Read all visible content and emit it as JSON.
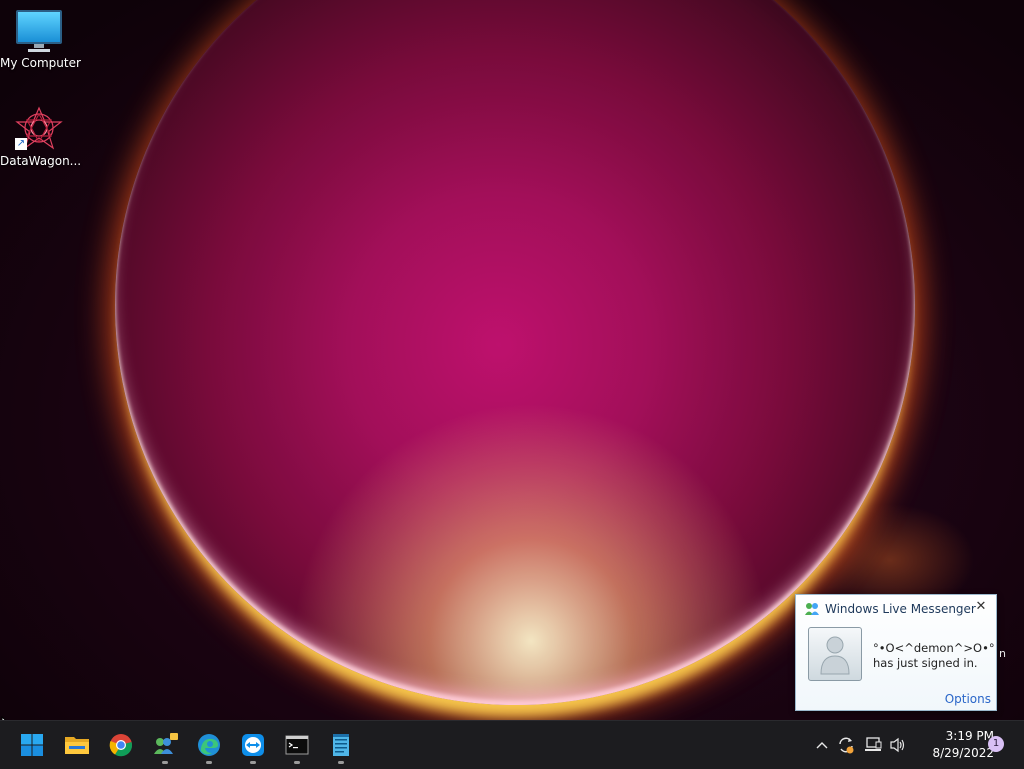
{
  "desktop": {
    "icons": [
      {
        "label": "My Computer",
        "icon": "computer-monitor-icon"
      },
      {
        "label": "DataWagon...",
        "icon": "datawagon-icon"
      }
    ]
  },
  "toast": {
    "app_name": "Windows Live Messenger",
    "line1": "°•O<^demon^>O•°",
    "line2": "has just signed in.",
    "options_link": "Options",
    "close_glyph": "✕",
    "side_fragment": "n"
  },
  "taskbar": {
    "apps": [
      {
        "name": "Start",
        "icon": "windows-start-icon"
      },
      {
        "name": "File Explorer",
        "icon": "folder-icon"
      },
      {
        "name": "Google Chrome",
        "icon": "chrome-icon"
      },
      {
        "name": "Windows Live Messenger",
        "icon": "messenger-icon"
      },
      {
        "name": "Microsoft Edge",
        "icon": "edge-icon"
      },
      {
        "name": "TeamViewer",
        "icon": "teamviewer-icon"
      },
      {
        "name": "Command Prompt",
        "icon": "terminal-icon"
      },
      {
        "name": "Notepad",
        "icon": "notepad-icon"
      }
    ],
    "tray": {
      "chevron_glyph": "^",
      "time": "3:19 PM",
      "date": "8/29/2022",
      "notification_count": "1"
    }
  },
  "colors": {
    "taskbar_bg": "#1c1c1f",
    "accent_blue": "#0a84d6",
    "link_blue": "#2a66c9"
  }
}
